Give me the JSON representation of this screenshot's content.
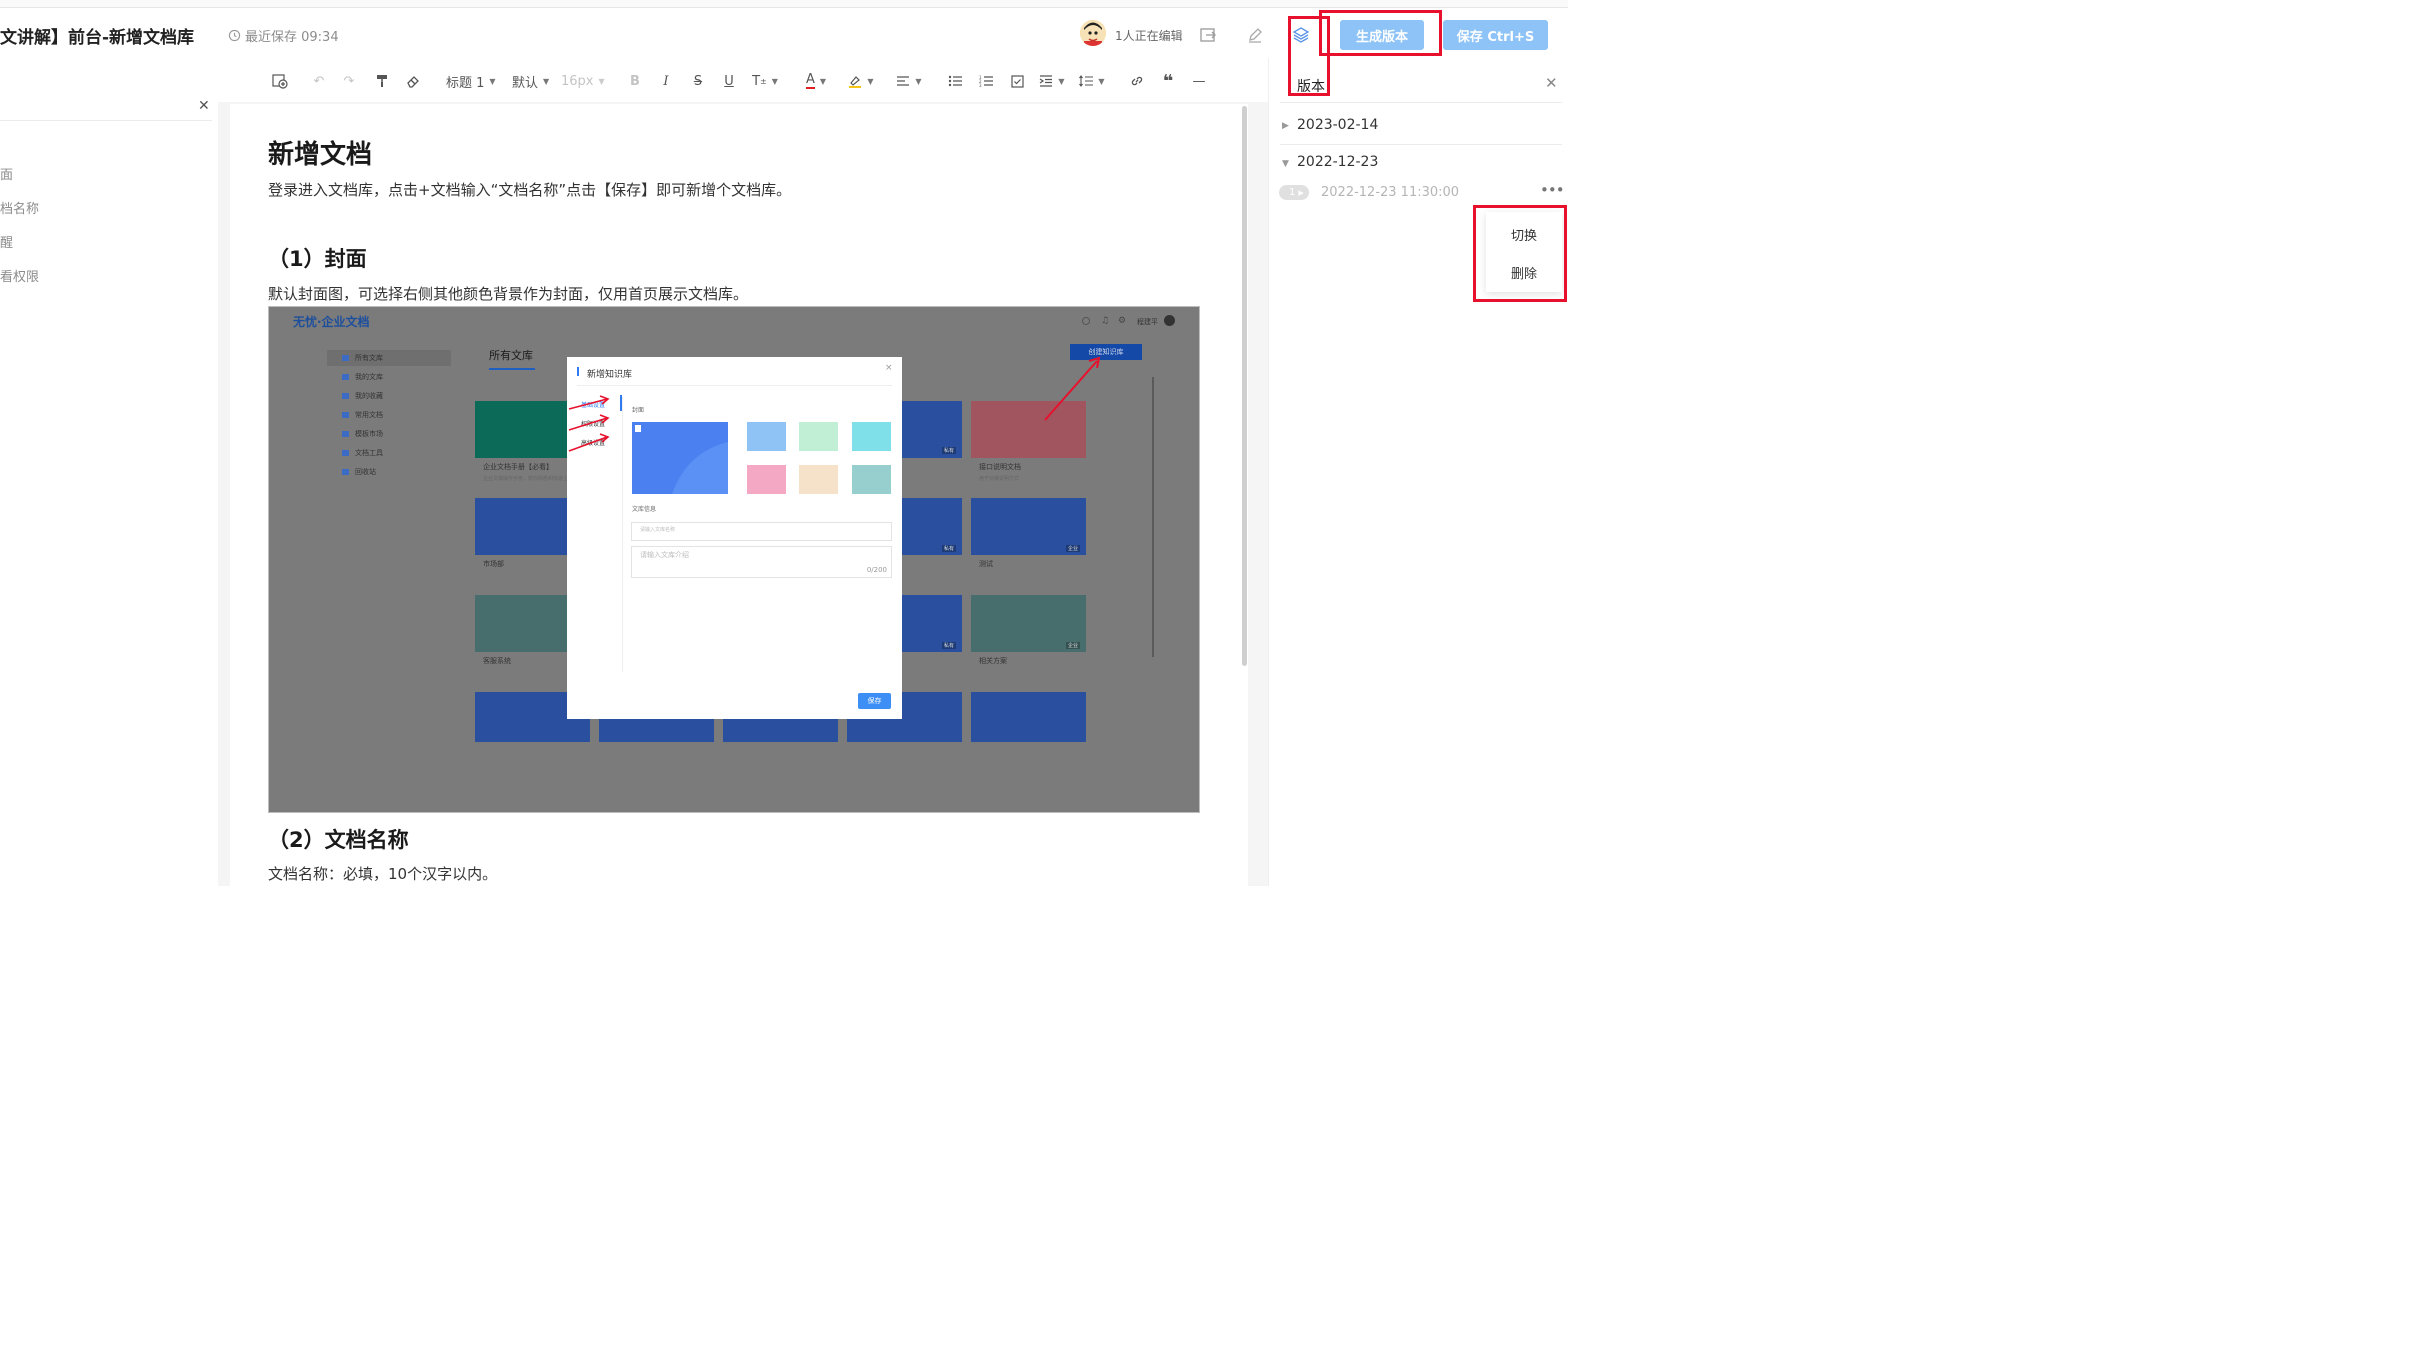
{
  "header": {
    "doc_title": "文讲解】前台-新增文档库",
    "saved_text": "最近保存 09:34",
    "editing_text": "1人正在编辑",
    "generate_version_label": "生成版本",
    "save_label": "保存 Ctrl+S"
  },
  "toolbar": {
    "heading": "标题 1",
    "font": "默认",
    "size": "16px"
  },
  "outline": {
    "items": [
      "面",
      "档名称",
      "醒",
      "看权限"
    ]
  },
  "document": {
    "title": "新增文档",
    "intro": "登录进入文档库，点击+文档输入“文档名称”点击【保存】即可新增个文档库。",
    "section1_title": "（1）封面",
    "section1_text": "默认封面图，可选择右侧其他颜色背景作为封面，仅用首页展示文档库。",
    "section2_title": "（2）文档名称",
    "section2_text": "文档名称：必填，10个汉字以内。"
  },
  "screenshot": {
    "logo": "无忧·企业文档",
    "user": "程建平",
    "all_libraries": "所有文库",
    "create_button": "创建知识库",
    "sidebar": [
      "所有文库",
      "我的文库",
      "我的收藏",
      "常用文档",
      "模板市场",
      "文档工具",
      "回收站"
    ],
    "cards": [
      {
        "caption": "企业文档手册【必看】",
        "sub": "企业文档操作手册，帮你熟悉和快速上手"
      },
      {
        "caption": "接口说明文档",
        "sub": "用于对接说明方式"
      },
      {
        "caption": "市场部",
        "sub": ""
      },
      {
        "caption": "测试",
        "sub": ""
      },
      {
        "caption": "客服系统",
        "sub": ""
      },
      {
        "caption": "相关方案",
        "sub": ""
      }
    ],
    "tags": [
      "私有",
      "私有",
      "企业",
      "私有",
      "企业"
    ],
    "modal": {
      "title": "新增知识库",
      "nav": [
        "基础设置",
        "权限设置",
        "高级设置"
      ],
      "cover_label": "封面",
      "info_label": "文库信息",
      "name_placeholder": "请输入文库名称",
      "desc_placeholder": "请输入文库介绍",
      "counter": "0/200",
      "save_button": "保存",
      "swatches": [
        "#8fc3f5",
        "#c1efd6",
        "#7fe0ea",
        "#f5a8c4",
        "#f5e2c8",
        "#97cfcf"
      ]
    }
  },
  "versions": {
    "panel_title": "版本",
    "dates": [
      "2023-02-14",
      "2022-12-23"
    ],
    "version_badge": "1",
    "version_time": "2022-12-23 11:30:00",
    "menu": [
      "切换",
      "删除"
    ]
  },
  "colors": {
    "accent": "#8ec3f7",
    "highlight": "#e8112d"
  }
}
